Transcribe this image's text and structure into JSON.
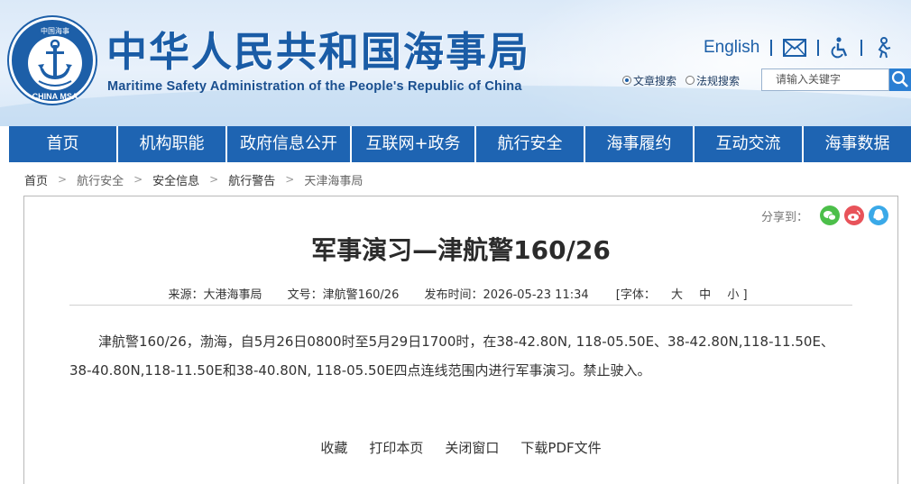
{
  "header": {
    "title": "中华人民共和国海事局",
    "subtitle": "Maritime Safety Administration of the People's Republic of China",
    "logo_text": "CHINA MSA",
    "logo_top_text": "中国海事",
    "english_link": "English",
    "icons": [
      "mail-icon",
      "accessibility-icon",
      "elder-mode-icon"
    ],
    "search": {
      "option_article": "文章搜索",
      "option_law": "法规搜索",
      "placeholder": "请输入关键字"
    }
  },
  "nav": {
    "items": [
      {
        "label": "首页"
      },
      {
        "label": "机构职能"
      },
      {
        "label": "政府信息公开"
      },
      {
        "label": "互联网+政务"
      },
      {
        "label": "航行安全"
      },
      {
        "label": "海事履约"
      },
      {
        "label": "互动交流"
      },
      {
        "label": "海事数据"
      }
    ]
  },
  "breadcrumb": [
    "首页",
    "航行安全",
    "安全信息",
    "航行警告",
    "天津海事局"
  ],
  "article": {
    "share_label": "分享到：",
    "title": "军事演习—津航警160/26",
    "source": "来源：大港海事局",
    "doc_no": "文号：津航警160/26",
    "published": "发布时间：2026-05-23 11:34",
    "font_label": "[字体：",
    "font_large": "大",
    "font_medium": "中",
    "font_small": "小 ]",
    "body": "津航警160/26，渤海，自5月26日0800时至5月29日1700时，在38-42.80N, 118-05.50E、38-42.80N,118-11.50E、38-40.80N,118-11.50E和38-40.80N, 118-05.50E四点连线范围内进行军事演习。禁止驶入。",
    "actions": [
      "收藏",
      "打印本页",
      "关闭窗口",
      "下载PDF文件"
    ]
  },
  "colors": {
    "brand_blue": "#1d5ea8",
    "wechat": "#4cbf4a",
    "weibo": "#e8535a",
    "qq": "#3aa9e8"
  }
}
